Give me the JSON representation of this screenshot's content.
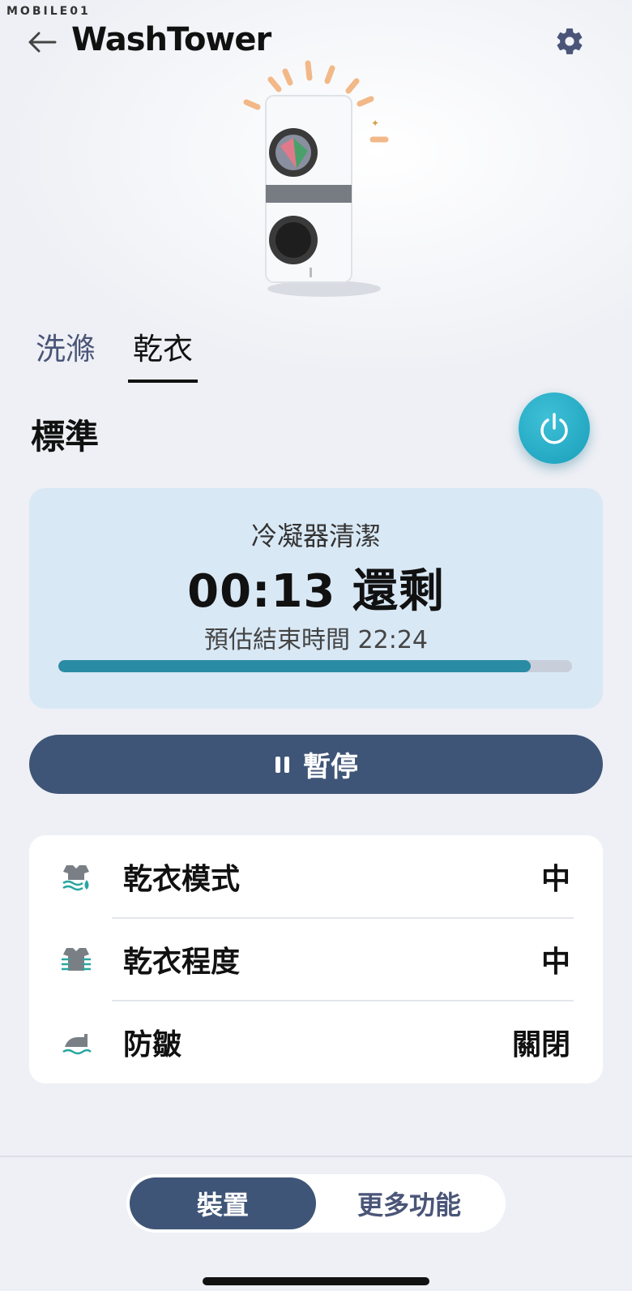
{
  "header": {
    "watermark": "MOBILE01",
    "title": "WashTower",
    "back_icon": "arrow-left-icon",
    "settings_icon": "gear-icon"
  },
  "tabs": [
    {
      "label": "洗滌",
      "active": false
    },
    {
      "label": "乾衣",
      "active": true
    }
  ],
  "mode": {
    "title": "標準",
    "power_icon": "power-icon"
  },
  "status": {
    "label": "冷凝器清潔",
    "remaining": "00:13 還剩",
    "end_time": "預估結束時間 22:24",
    "progress": 0.92
  },
  "pause_button": {
    "label": "暫停",
    "icon": "pause-icon"
  },
  "options": [
    {
      "icon": "dry-mode-icon",
      "label": "乾衣模式",
      "value": "中"
    },
    {
      "icon": "dry-level-icon",
      "label": "乾衣程度",
      "value": "中"
    },
    {
      "icon": "iron-icon",
      "label": "防皺",
      "value": "關閉"
    }
  ],
  "bottom_nav": {
    "items": [
      {
        "label": "裝置",
        "active": true
      },
      {
        "label": "更多功能",
        "active": false
      }
    ]
  },
  "colors": {
    "accent": "#3f5577",
    "power": "#1a9fbb",
    "progress": "#2a8ba4",
    "status_bg": "#d9e8f5"
  }
}
